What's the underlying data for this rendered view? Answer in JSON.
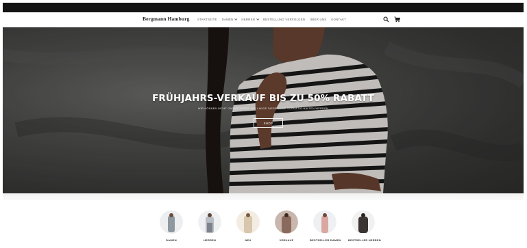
{
  "brand": "Bergmann Hamburg",
  "nav": [
    {
      "label": "STARTSEITE",
      "dropdown": false
    },
    {
      "label": "DAMEN",
      "dropdown": true
    },
    {
      "label": "HERREN",
      "dropdown": true
    },
    {
      "label": "BESTELLUNG VERFOLGEN",
      "dropdown": false
    },
    {
      "label": "ÜBER UNS",
      "dropdown": false
    },
    {
      "label": "KONTAKT",
      "dropdown": false
    }
  ],
  "header_icons": [
    "search-icon",
    "cart-icon"
  ],
  "hero": {
    "title": "FRÜHJAHRS-VERKAUF BIS ZU 50% RABATT",
    "subtitle": "WIR KÖNNEN NICHT GARANTIEREN, WIE LANGE DIESE WARE VORRÄTIG HALTEN WERDEN",
    "button": "SHOP"
  },
  "categories": [
    {
      "label": "DAMEN",
      "color": "#9aa3a8"
    },
    {
      "label": "HERREN",
      "color": "#b9bec4"
    },
    {
      "label": "NEU",
      "color": "#d8c6ad"
    },
    {
      "label": "VERKAUF",
      "color": "#8b6a5e"
    },
    {
      "label": "BESTSELLER DAMEN",
      "color": "#d9a7a0"
    },
    {
      "label": "BESTSELLER HERREN",
      "color": "#3a3533"
    }
  ]
}
